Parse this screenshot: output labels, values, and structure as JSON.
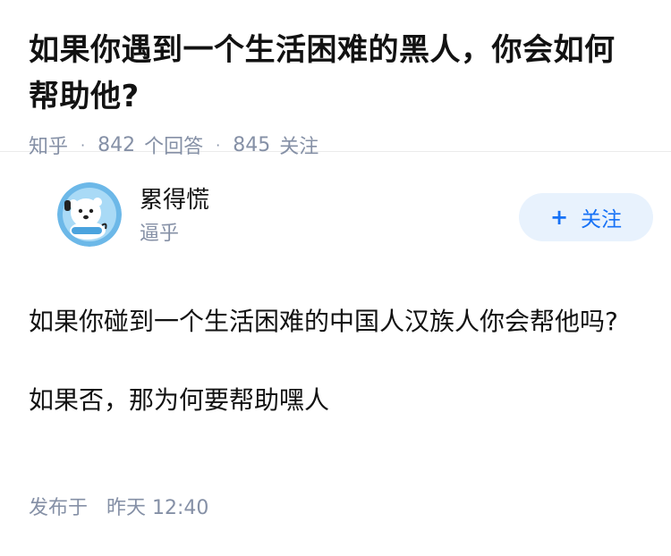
{
  "question": {
    "title": "如果你遇到一个生活困难的黑人，你会如何帮助他?",
    "source": "知乎",
    "answer_count": "842",
    "answer_label": "个回答",
    "follower_count": "845",
    "follower_label": "关注"
  },
  "answer": {
    "author": {
      "name": "累得慌",
      "bio": "逼乎",
      "avatar_icon": "polar-bear-avatar-icon"
    },
    "follow_button": {
      "icon": "plus-icon",
      "label": "关注"
    },
    "content": [
      "如果你碰到一个生活困难的中国人汉族人你会帮他吗?",
      "如果否，那为何要帮助嘿人"
    ],
    "publish": {
      "label": "发布于",
      "time": "昨天 12:40"
    }
  },
  "colors": {
    "accent": "#1772f6",
    "button_bg": "#e8f2fd",
    "meta": "#8590a6",
    "text": "#121212"
  }
}
